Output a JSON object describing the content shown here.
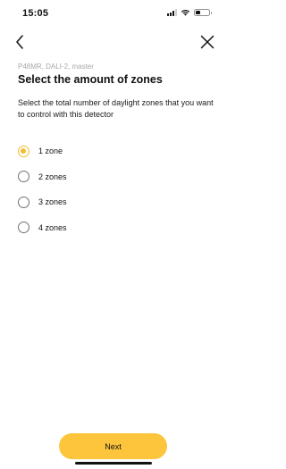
{
  "status_bar": {
    "time": "15:05",
    "battery_level": 0.45
  },
  "nav": {
    "back_icon": "chevron-left-icon",
    "close_icon": "close-icon"
  },
  "device_subtitle": "P48MR, DALI-2, master",
  "title": "Select the amount of zones",
  "description": "Select the total number of daylight zones that you want to control with this detector",
  "zone_options": [
    {
      "label": "1 zone",
      "selected": true
    },
    {
      "label": "2 zones",
      "selected": false
    },
    {
      "label": "3 zones",
      "selected": false
    },
    {
      "label": "4 zones",
      "selected": false
    }
  ],
  "colors": {
    "accent": "#fcc53b",
    "radio_selected": "#f5bd2f",
    "subtitle_gray": "#a8a8a8"
  },
  "next_button_label": "Next"
}
